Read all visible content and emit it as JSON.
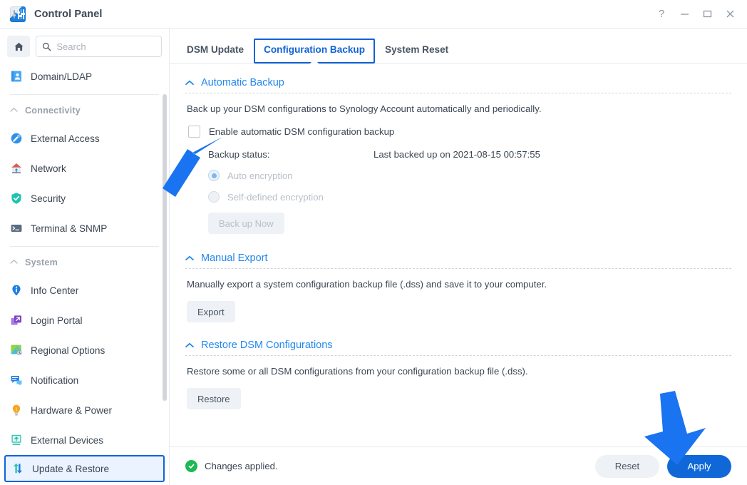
{
  "window": {
    "title": "Control Panel",
    "app_icon": "control-panel-icon",
    "controls": [
      {
        "name": "help-button",
        "glyph": "?"
      },
      {
        "name": "minimize-button",
        "glyph": "–"
      },
      {
        "name": "maximize-button",
        "glyph": "□"
      },
      {
        "name": "close-button",
        "glyph": "×"
      }
    ]
  },
  "sidebar": {
    "home_icon": "home-icon",
    "search": {
      "value": "",
      "placeholder": "Search",
      "icon": "search-icon"
    },
    "top_item": {
      "label": "Domain/LDAP",
      "icon": "domain-ldap-icon"
    },
    "groups": [
      {
        "label": "Connectivity",
        "icon": "chevron-up-icon",
        "items": [
          {
            "label": "External Access",
            "icon": "external-access-icon"
          },
          {
            "label": "Network",
            "icon": "network-icon"
          },
          {
            "label": "Security",
            "icon": "security-icon"
          },
          {
            "label": "Terminal & SNMP",
            "icon": "terminal-snmp-icon"
          }
        ]
      },
      {
        "label": "System",
        "icon": "chevron-up-icon",
        "items": [
          {
            "label": "Info Center",
            "icon": "info-center-icon"
          },
          {
            "label": "Login Portal",
            "icon": "login-portal-icon"
          },
          {
            "label": "Regional Options",
            "icon": "regional-options-icon"
          },
          {
            "label": "Notification",
            "icon": "notification-icon"
          },
          {
            "label": "Hardware & Power",
            "icon": "hardware-power-icon"
          },
          {
            "label": "External Devices",
            "icon": "external-devices-icon"
          },
          {
            "label": "Update & Restore",
            "icon": "update-restore-icon",
            "selected": true
          }
        ]
      }
    ]
  },
  "main": {
    "tabs": [
      {
        "label": "DSM Update",
        "active": false
      },
      {
        "label": "Configuration Backup",
        "active": true,
        "highlighted": true
      },
      {
        "label": "System Reset",
        "active": false
      }
    ],
    "sections": {
      "automatic_backup": {
        "title": "Automatic Backup",
        "chevron": "chevron-up-icon",
        "description": "Back up your DSM configurations to Synology Account automatically and periodically.",
        "checkbox": {
          "label": "Enable automatic DSM configuration backup",
          "checked": false
        },
        "status_label": "Backup status:",
        "status_value": "Last backed up on 2021-08-15 00:57:55",
        "radios": [
          {
            "label": "Auto encryption",
            "selected": true,
            "disabled": true
          },
          {
            "label": "Self-defined encryption",
            "selected": false,
            "disabled": true
          }
        ],
        "backup_now_button": {
          "label": "Back up Now",
          "disabled": true
        }
      },
      "manual_export": {
        "title": "Manual Export",
        "chevron": "chevron-up-icon",
        "description": "Manually export a system configuration backup file (.dss) and save it to your computer.",
        "button": {
          "label": "Export"
        }
      },
      "restore": {
        "title": "Restore DSM Configurations",
        "chevron": "chevron-up-icon",
        "description": "Restore some or all DSM configurations from your configuration backup file (.dss).",
        "button": {
          "label": "Restore"
        }
      }
    }
  },
  "footer": {
    "status_icon": "check-circle-icon",
    "status_text": "Changes applied.",
    "reset_label": "Reset",
    "apply_label": "Apply"
  },
  "annotations": [
    {
      "name": "arrow-to-checkbox",
      "direction": "up-right",
      "color": "#1a73f0"
    },
    {
      "name": "arrow-to-apply-button",
      "direction": "down",
      "color": "#1a73f0"
    }
  ],
  "colors": {
    "accent": "#1068d8",
    "link": "#2288ee",
    "highlight_ring": "#1163d6",
    "success": "#1db954",
    "annotation": "#1a73f0"
  }
}
